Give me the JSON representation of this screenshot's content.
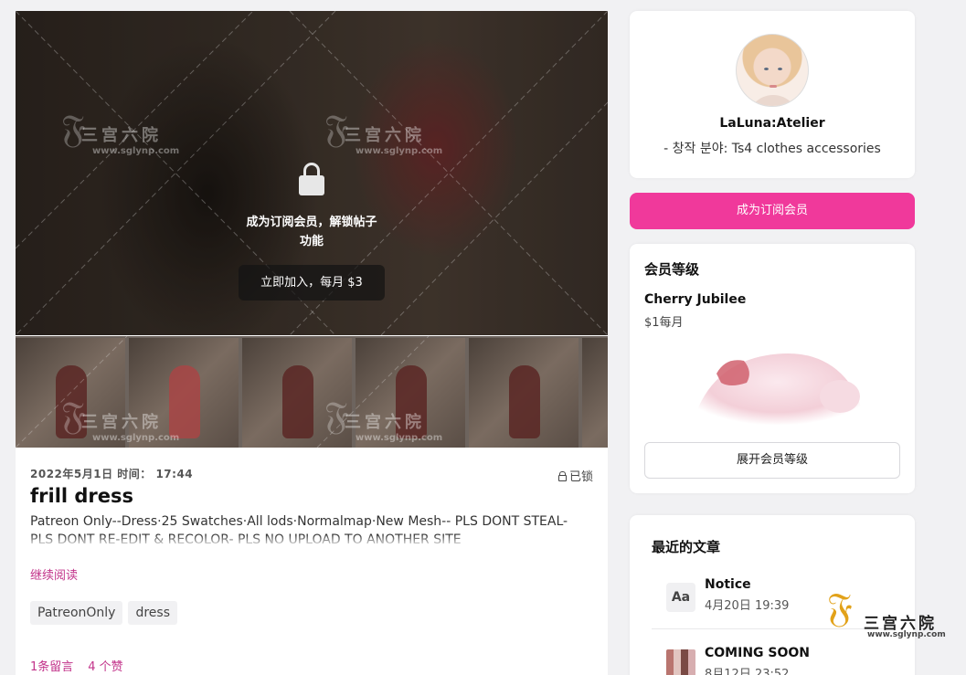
{
  "post": {
    "lock_message_line1": "成为订阅会员，解锁帖子",
    "lock_message_line2": "功能",
    "join_button": "立即加入，每月 $3",
    "meta": "2022年5月1日 时间： 17:44",
    "locked_label": "已锁",
    "title": "frill dress",
    "description": "Patreon Only--Dress·25  Swatches·All lods·Normalmap·New Mesh-- PLS DONT STEAL- PLS DONT RE-EDIT & RECOLOR- PLS NO UPLOAD TO ANOTHER SITE",
    "read_more": "继续阅读",
    "tags": [
      "PatreonOnly",
      "dress"
    ],
    "comments": "1条留言",
    "likes": "4 个赞"
  },
  "watermark": {
    "cn": "三宫六院",
    "url": "www.sglynp.com"
  },
  "creator": {
    "name": "LaLuna:Atelier",
    "field": "- 창작 분야: Ts4 clothes accessories"
  },
  "subscribe_button": "成为订阅会员",
  "tiers": {
    "title": "会员等级",
    "tier_name": "Cherry Jubilee",
    "tier_price": "$1每月",
    "expand_button": "展开会员等级"
  },
  "recent": {
    "title": "最近的文章",
    "articles": [
      {
        "icon_text": "Aa",
        "title": "Notice",
        "date": "4月20日 19:39"
      },
      {
        "title": "COMING SOON",
        "date": "8月12日 23:52"
      }
    ]
  },
  "colors": {
    "accent": "#f0399b",
    "link": "#c2338a",
    "background": "#f1f1f3"
  }
}
